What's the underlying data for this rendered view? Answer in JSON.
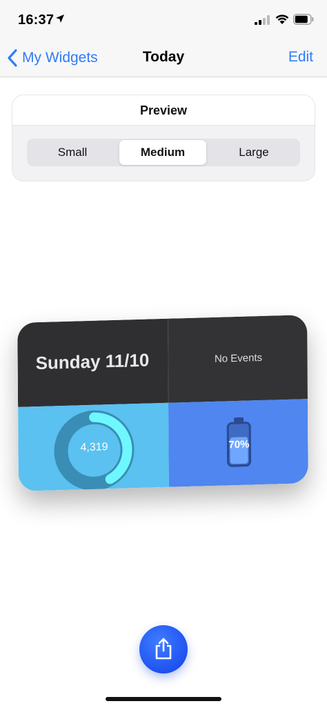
{
  "status_bar": {
    "time": "16:37",
    "battery_level": 0.8
  },
  "nav": {
    "back_label": "My Widgets",
    "title": "Today",
    "edit_label": "Edit"
  },
  "preview": {
    "title": "Preview",
    "sizes": [
      "Small",
      "Medium",
      "Large"
    ],
    "selected": "Medium"
  },
  "widget": {
    "date": "Sunday 11/10",
    "events": "No Events",
    "steps": "4,319",
    "steps_progress": 0.42,
    "battery": "70%",
    "battery_level": 0.7
  },
  "colors": {
    "accent": "#2f7cf6",
    "widget_dark": "#2f2f31",
    "widget_light_blue": "#5ac1f0",
    "widget_blue": "#4f86f0",
    "ring_track": "#3a8db5",
    "ring_progress": "#6ff7ff",
    "share_button": "#1f52f0"
  },
  "icons": {
    "location": "location-arrow-icon",
    "signal": "cellular-signal-icon",
    "wifi": "wifi-icon",
    "battery": "battery-icon",
    "back": "chevron-left-icon",
    "share": "share-icon"
  }
}
